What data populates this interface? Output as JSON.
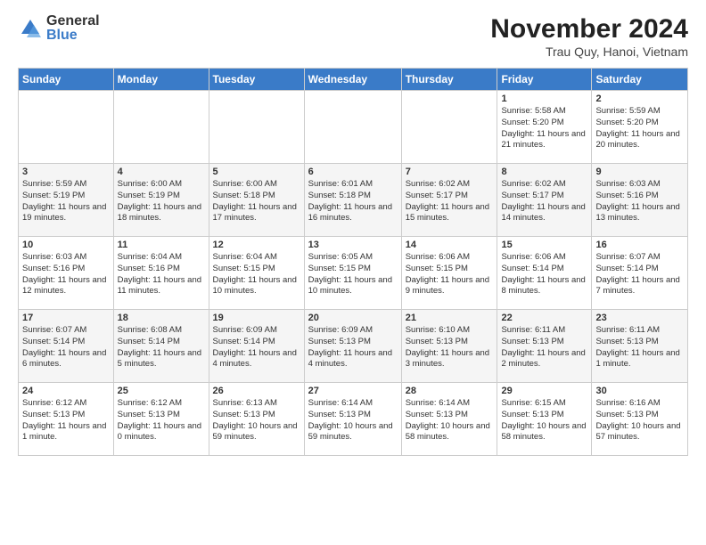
{
  "logo": {
    "general": "General",
    "blue": "Blue"
  },
  "title": "November 2024",
  "subtitle": "Trau Quy, Hanoi, Vietnam",
  "header_days": [
    "Sunday",
    "Monday",
    "Tuesday",
    "Wednesday",
    "Thursday",
    "Friday",
    "Saturday"
  ],
  "weeks": [
    [
      {
        "day": "",
        "info": ""
      },
      {
        "day": "",
        "info": ""
      },
      {
        "day": "",
        "info": ""
      },
      {
        "day": "",
        "info": ""
      },
      {
        "day": "",
        "info": ""
      },
      {
        "day": "1",
        "info": "Sunrise: 5:58 AM\nSunset: 5:20 PM\nDaylight: 11 hours\nand 21 minutes."
      },
      {
        "day": "2",
        "info": "Sunrise: 5:59 AM\nSunset: 5:20 PM\nDaylight: 11 hours\nand 20 minutes."
      }
    ],
    [
      {
        "day": "3",
        "info": "Sunrise: 5:59 AM\nSunset: 5:19 PM\nDaylight: 11 hours\nand 19 minutes."
      },
      {
        "day": "4",
        "info": "Sunrise: 6:00 AM\nSunset: 5:19 PM\nDaylight: 11 hours\nand 18 minutes."
      },
      {
        "day": "5",
        "info": "Sunrise: 6:00 AM\nSunset: 5:18 PM\nDaylight: 11 hours\nand 17 minutes."
      },
      {
        "day": "6",
        "info": "Sunrise: 6:01 AM\nSunset: 5:18 PM\nDaylight: 11 hours\nand 16 minutes."
      },
      {
        "day": "7",
        "info": "Sunrise: 6:02 AM\nSunset: 5:17 PM\nDaylight: 11 hours\nand 15 minutes."
      },
      {
        "day": "8",
        "info": "Sunrise: 6:02 AM\nSunset: 5:17 PM\nDaylight: 11 hours\nand 14 minutes."
      },
      {
        "day": "9",
        "info": "Sunrise: 6:03 AM\nSunset: 5:16 PM\nDaylight: 11 hours\nand 13 minutes."
      }
    ],
    [
      {
        "day": "10",
        "info": "Sunrise: 6:03 AM\nSunset: 5:16 PM\nDaylight: 11 hours\nand 12 minutes."
      },
      {
        "day": "11",
        "info": "Sunrise: 6:04 AM\nSunset: 5:16 PM\nDaylight: 11 hours\nand 11 minutes."
      },
      {
        "day": "12",
        "info": "Sunrise: 6:04 AM\nSunset: 5:15 PM\nDaylight: 11 hours\nand 10 minutes."
      },
      {
        "day": "13",
        "info": "Sunrise: 6:05 AM\nSunset: 5:15 PM\nDaylight: 11 hours\nand 10 minutes."
      },
      {
        "day": "14",
        "info": "Sunrise: 6:06 AM\nSunset: 5:15 PM\nDaylight: 11 hours\nand 9 minutes."
      },
      {
        "day": "15",
        "info": "Sunrise: 6:06 AM\nSunset: 5:14 PM\nDaylight: 11 hours\nand 8 minutes."
      },
      {
        "day": "16",
        "info": "Sunrise: 6:07 AM\nSunset: 5:14 PM\nDaylight: 11 hours\nand 7 minutes."
      }
    ],
    [
      {
        "day": "17",
        "info": "Sunrise: 6:07 AM\nSunset: 5:14 PM\nDaylight: 11 hours\nand 6 minutes."
      },
      {
        "day": "18",
        "info": "Sunrise: 6:08 AM\nSunset: 5:14 PM\nDaylight: 11 hours\nand 5 minutes."
      },
      {
        "day": "19",
        "info": "Sunrise: 6:09 AM\nSunset: 5:14 PM\nDaylight: 11 hours\nand 4 minutes."
      },
      {
        "day": "20",
        "info": "Sunrise: 6:09 AM\nSunset: 5:13 PM\nDaylight: 11 hours\nand 4 minutes."
      },
      {
        "day": "21",
        "info": "Sunrise: 6:10 AM\nSunset: 5:13 PM\nDaylight: 11 hours\nand 3 minutes."
      },
      {
        "day": "22",
        "info": "Sunrise: 6:11 AM\nSunset: 5:13 PM\nDaylight: 11 hours\nand 2 minutes."
      },
      {
        "day": "23",
        "info": "Sunrise: 6:11 AM\nSunset: 5:13 PM\nDaylight: 11 hours\nand 1 minute."
      }
    ],
    [
      {
        "day": "24",
        "info": "Sunrise: 6:12 AM\nSunset: 5:13 PM\nDaylight: 11 hours\nand 1 minute."
      },
      {
        "day": "25",
        "info": "Sunrise: 6:12 AM\nSunset: 5:13 PM\nDaylight: 11 hours\nand 0 minutes."
      },
      {
        "day": "26",
        "info": "Sunrise: 6:13 AM\nSunset: 5:13 PM\nDaylight: 10 hours\nand 59 minutes."
      },
      {
        "day": "27",
        "info": "Sunrise: 6:14 AM\nSunset: 5:13 PM\nDaylight: 10 hours\nand 59 minutes."
      },
      {
        "day": "28",
        "info": "Sunrise: 6:14 AM\nSunset: 5:13 PM\nDaylight: 10 hours\nand 58 minutes."
      },
      {
        "day": "29",
        "info": "Sunrise: 6:15 AM\nSunset: 5:13 PM\nDaylight: 10 hours\nand 58 minutes."
      },
      {
        "day": "30",
        "info": "Sunrise: 6:16 AM\nSunset: 5:13 PM\nDaylight: 10 hours\nand 57 minutes."
      }
    ]
  ]
}
